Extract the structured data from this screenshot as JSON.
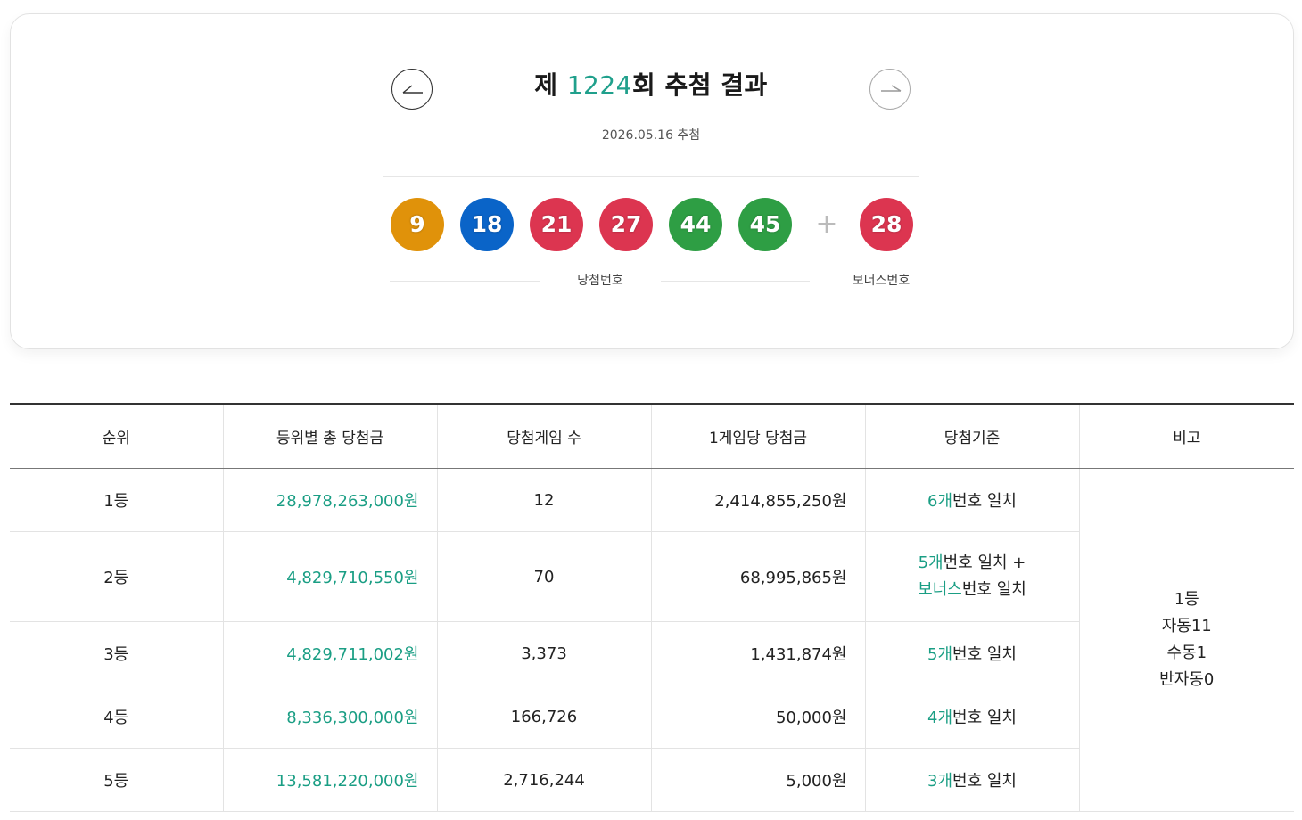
{
  "header": {
    "title_prefix": "제 ",
    "round": "1224",
    "title_suffix": "회 추첨 결과",
    "draw_date": "2026.05.16 추첨",
    "prev_icon": "arrow-left-icon",
    "next_icon": "arrow-right-icon"
  },
  "balls": {
    "winning": [
      {
        "number": "9",
        "color": "#e0920a"
      },
      {
        "number": "18",
        "color": "#0a64c8"
      },
      {
        "number": "21",
        "color": "#dc3550"
      },
      {
        "number": "27",
        "color": "#dc3550"
      },
      {
        "number": "44",
        "color": "#2e9e44"
      },
      {
        "number": "45",
        "color": "#2e9e44"
      }
    ],
    "plus": "+",
    "bonus": {
      "number": "28",
      "color": "#dc3550"
    },
    "winning_label": "당첨번호",
    "bonus_label": "보너스번호"
  },
  "table": {
    "headers": [
      "순위",
      "등위별 총 당첨금",
      "당첨게임 수",
      "1게임당 당첨금",
      "당첨기준",
      "비고"
    ],
    "rows": [
      {
        "rank": "1등",
        "total": "28,978,263,000원",
        "games": "12",
        "per_game": "2,414,855,250원",
        "crit_a_hl": "6개",
        "crit_a_text": "번호 일치",
        "crit_b_hl": "",
        "crit_b_text": ""
      },
      {
        "rank": "2등",
        "total": "4,829,710,550원",
        "games": "70",
        "per_game": "68,995,865원",
        "crit_a_hl": "5개",
        "crit_a_text": "번호 일치 +",
        "crit_b_hl": "보너스",
        "crit_b_text": "번호 일치"
      },
      {
        "rank": "3등",
        "total": "4,829,711,002원",
        "games": "3,373",
        "per_game": "1,431,874원",
        "crit_a_hl": "5개",
        "crit_a_text": "번호 일치",
        "crit_b_hl": "",
        "crit_b_text": ""
      },
      {
        "rank": "4등",
        "total": "8,336,300,000원",
        "games": "166,726",
        "per_game": "50,000원",
        "crit_a_hl": "4개",
        "crit_a_text": "번호 일치",
        "crit_b_hl": "",
        "crit_b_text": ""
      },
      {
        "rank": "5등",
        "total": "13,581,220,000원",
        "games": "2,716,244",
        "per_game": "5,000원",
        "crit_a_hl": "3개",
        "crit_a_text": "번호 일치",
        "crit_b_hl": "",
        "crit_b_text": ""
      }
    ],
    "note": [
      "1등",
      "자동11",
      "수동1",
      "반자동0"
    ]
  },
  "colors": {
    "accent": "#20a08c",
    "text": "#1a1a1a"
  }
}
